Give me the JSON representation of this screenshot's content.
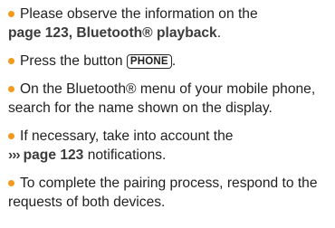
{
  "colors": {
    "bullet": "#f19a1b",
    "text": "#1f1f1f"
  },
  "icons": {
    "bullet": "bullet-dot-icon",
    "reference_arrow": "reference-arrows-icon"
  },
  "steps": [
    {
      "text_before": "Please observe the information on the",
      "reference": "page 123, Bluetooth® playback",
      "text_after": "."
    },
    {
      "text_before": "Press the button",
      "button_label": "PHONE",
      "text_after": "."
    },
    {
      "text": "On the Bluetooth® menu of your mobile phone, search for the name shown on the display."
    },
    {
      "text_before": "If necessary, take into account the",
      "reference_arrows": "›››",
      "reference": "page 123",
      "text_after": "notifications."
    },
    {
      "text": "To complete the pairing process, respond to the requests of both devices."
    }
  ]
}
